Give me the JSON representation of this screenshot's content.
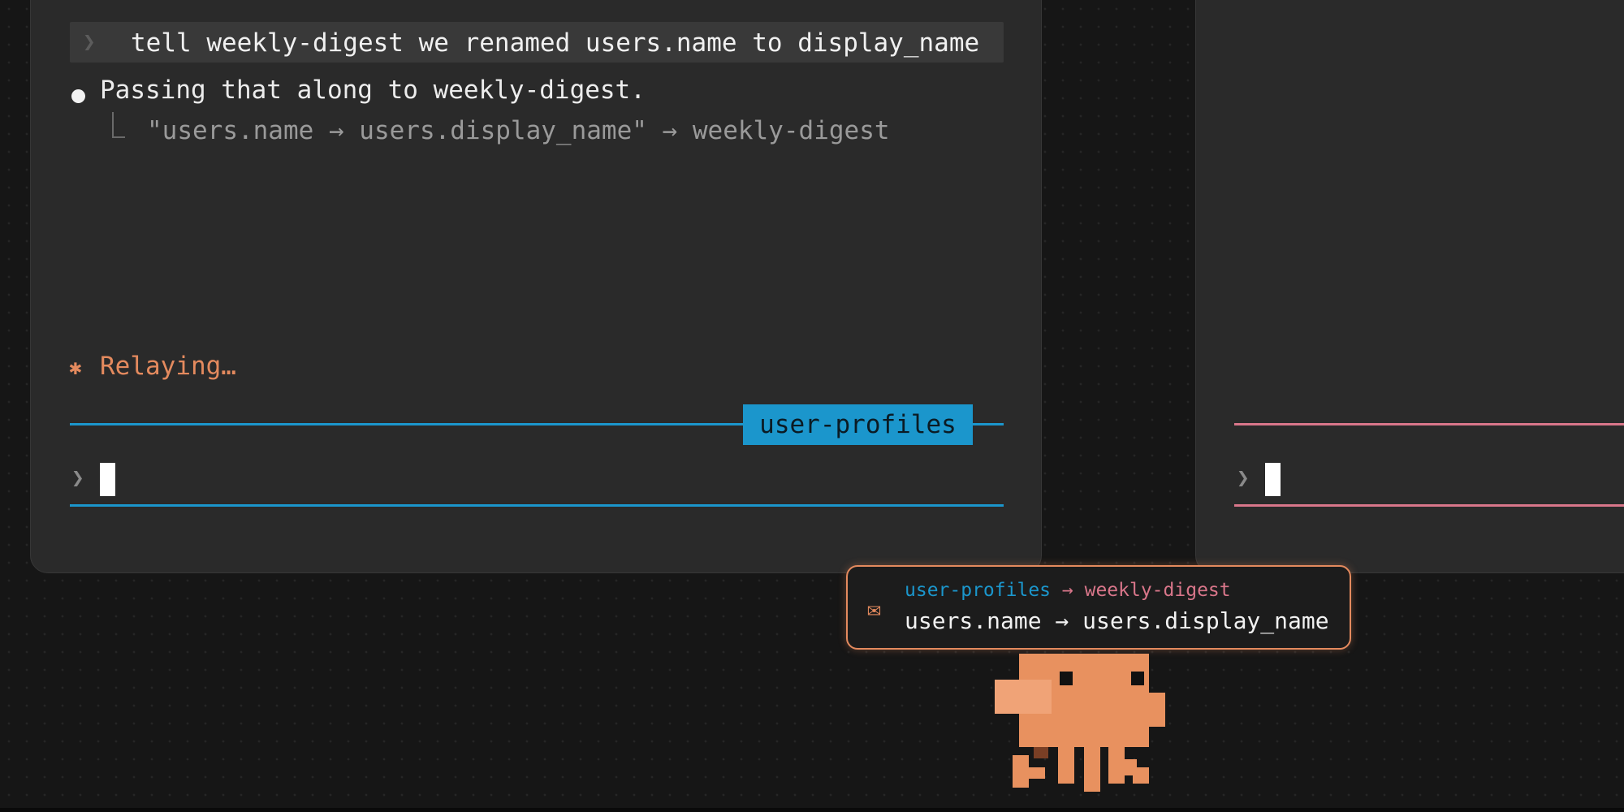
{
  "left_panel": {
    "user_message": "tell weekly-digest we renamed users.name to display_name",
    "reply": "Passing that along to weekly-digest.",
    "detail": "\"users.name → users.display_name\" → weekly-digest",
    "status": "Relaying…",
    "status_icon": "asterisk-icon",
    "agent_label": "user-profiles",
    "accent_color": "#1b96cc",
    "prompt_chevron": "❯"
  },
  "right_panel": {
    "prompt_chevron": "❯",
    "accent_color": "#d9768a"
  },
  "toast": {
    "icon": "envelope-icon",
    "from": "user-profiles",
    "arrow": "→",
    "to": "weekly-digest",
    "body": "users.name → users.display_name",
    "border_color": "#e48a5e"
  },
  "mascot": {
    "icon": "octopus-pixel-mascot",
    "color": "#e8915f"
  }
}
